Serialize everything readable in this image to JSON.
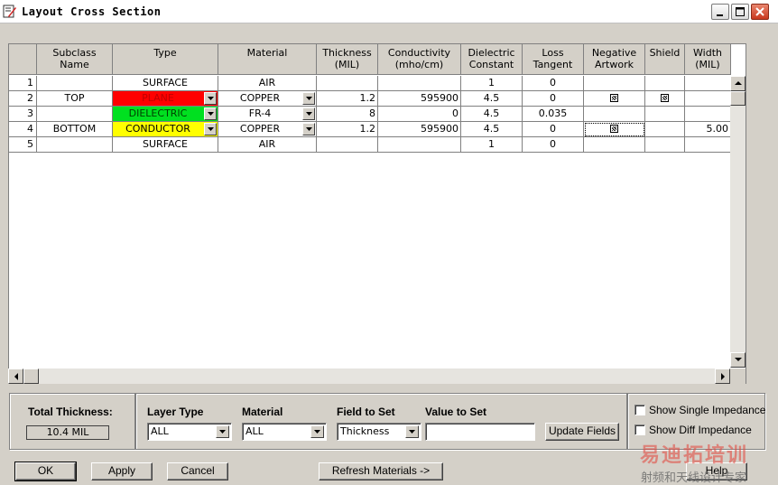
{
  "window": {
    "title": "Layout Cross Section"
  },
  "columns": [
    "",
    "Subclass Name",
    "Type",
    "Material",
    "Thickness\n(MIL)",
    "Conductivity\n(mho/cm)",
    "Dielectric\nConstant",
    "Loss\nTangent",
    "Negative\nArtwork",
    "Shield",
    "Width\n(MIL)"
  ],
  "rows": [
    {
      "num": "1",
      "subclass": "",
      "type": "SURFACE",
      "type_color": "#ffffff",
      "type_text_color": "#000000",
      "type_dropdown": false,
      "material": "AIR",
      "material_dropdown": false,
      "thickness": "",
      "conductivity": "",
      "dielectric": "1",
      "loss": "0",
      "negative": false,
      "shield": false,
      "width": ""
    },
    {
      "num": "2",
      "subclass": "TOP",
      "type": "PLANE",
      "type_color": "#ff0000",
      "type_text_color": "#c00000",
      "type_dropdown": true,
      "material": "COPPER",
      "material_dropdown": true,
      "thickness": "1.2",
      "conductivity": "595900",
      "dielectric": "4.5",
      "loss": "0",
      "negative": true,
      "shield": true,
      "width": ""
    },
    {
      "num": "3",
      "subclass": "",
      "type": "DIELECTRIC",
      "type_color": "#00e020",
      "type_text_color": "#004000",
      "type_dropdown": true,
      "material": "FR-4",
      "material_dropdown": true,
      "thickness": "8",
      "conductivity": "0",
      "dielectric": "4.5",
      "loss": "0.035",
      "negative": false,
      "shield": false,
      "width": ""
    },
    {
      "num": "4",
      "subclass": "BOTTOM",
      "type": "CONDUCTOR",
      "type_color": "#ffff00",
      "type_text_color": "#000000",
      "type_dropdown": true,
      "material": "COPPER",
      "material_dropdown": true,
      "thickness": "1.2",
      "conductivity": "595900",
      "dielectric": "4.5",
      "loss": "0",
      "negative": true,
      "shield": false,
      "width": "5.00"
    },
    {
      "num": "5",
      "subclass": "",
      "type": "SURFACE",
      "type_color": "#ffffff",
      "type_text_color": "#000000",
      "type_dropdown": false,
      "material": "AIR",
      "material_dropdown": false,
      "thickness": "",
      "conductivity": "",
      "dielectric": "1",
      "loss": "0",
      "negative": false,
      "shield": false,
      "width": ""
    }
  ],
  "total_thickness": {
    "label": "Total Thickness:",
    "value": "10.4 MIL"
  },
  "filters": {
    "layer_type": {
      "label": "Layer Type",
      "value": "ALL"
    },
    "material": {
      "label": "Material",
      "value": "ALL"
    },
    "field_to_set": {
      "label": "Field to Set",
      "value": "Thickness"
    },
    "value_to_set": {
      "label": "Value to Set",
      "value": ""
    },
    "update_label": "Update Fields"
  },
  "options": {
    "single_impedance": {
      "label": "Show Single Impedance",
      "checked": false
    },
    "diff_impedance": {
      "label": "Show Diff Impedance",
      "checked": false
    }
  },
  "buttons": {
    "ok": "OK",
    "apply": "Apply",
    "cancel": "Cancel",
    "refresh": "Refresh Materials ->",
    "help": "Help"
  },
  "watermark": {
    "line1": "易迪拓培训",
    "line2": "射频和天线设计专家"
  }
}
